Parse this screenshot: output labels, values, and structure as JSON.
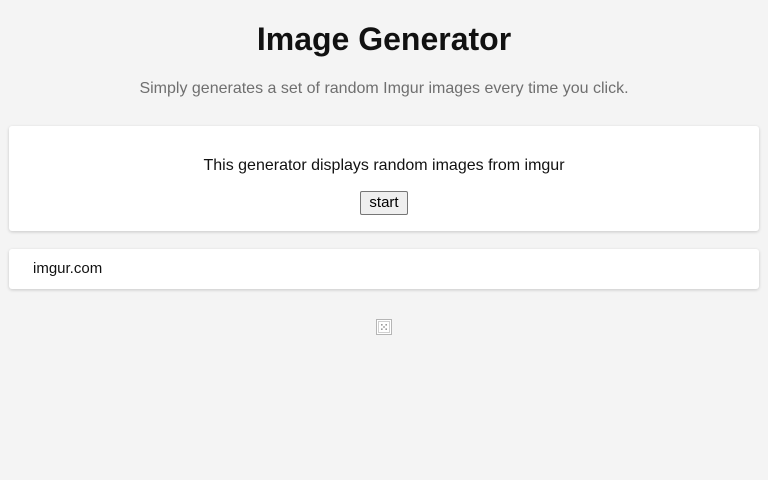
{
  "header": {
    "title": "Image Generator",
    "subtitle": "Simply generates a set of random Imgur images every time you click."
  },
  "generator": {
    "description": "This generator displays random images from imgur",
    "start_label": "start"
  },
  "source": {
    "link_text": "imgur.com"
  },
  "output": {
    "image_icon": "broken-image-icon"
  }
}
